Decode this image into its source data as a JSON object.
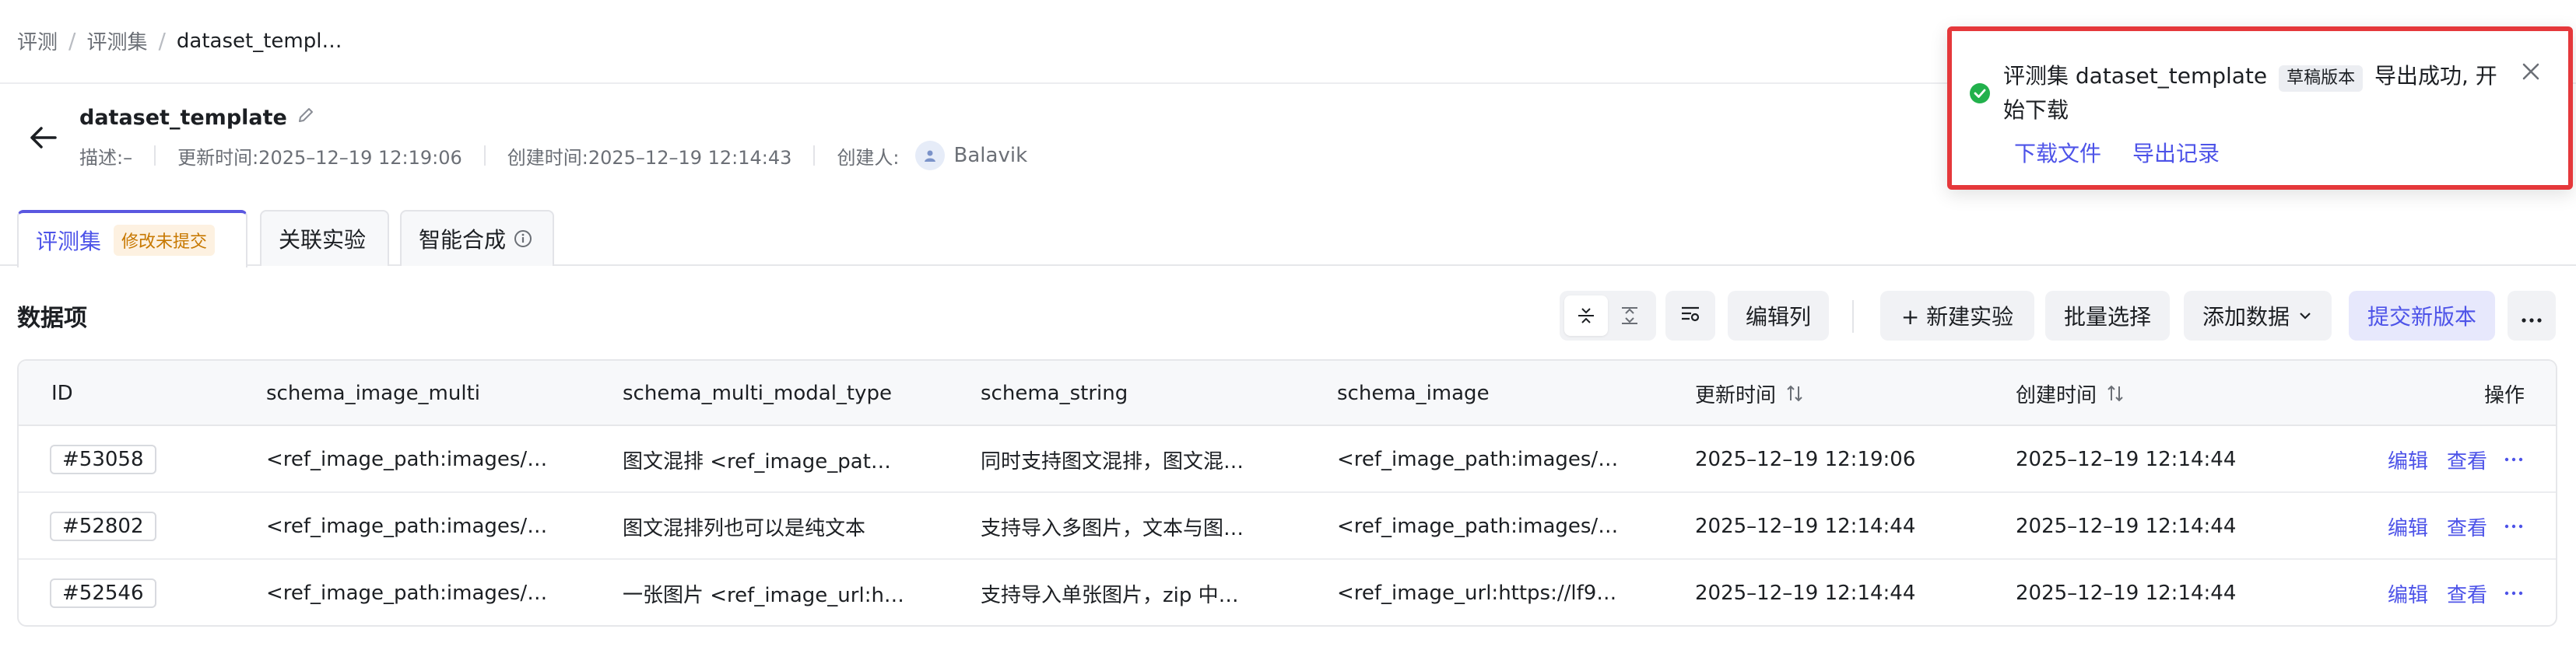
{
  "breadcrumb": [
    "评测",
    "评测集",
    "dataset_templ…"
  ],
  "header": {
    "title": "dataset_template",
    "description": "描述:–",
    "updated": "更新时间:2025–12–19 12:19:06",
    "created": "创建时间:2025–12–19 12:14:43",
    "creator_label": "创建人:",
    "creator_name": "Balavik"
  },
  "tabs": [
    {
      "label": "评测集",
      "badge": "修改未提交"
    },
    {
      "label": "关联实验"
    },
    {
      "label": "智能合成"
    }
  ],
  "section_title": "数据项",
  "toolbar": {
    "edit_columns": "编辑列",
    "new_experiment": "+ 新建实验",
    "batch_select": "批量选择",
    "add_data": "添加数据",
    "submit_version": "提交新版本"
  },
  "table": {
    "columns": [
      "ID",
      "schema_image_multi",
      "schema_multi_modal_type",
      "schema_string",
      "schema_image",
      "更新时间",
      "创建时间",
      "操作"
    ],
    "rows": [
      {
        "id": "#53058",
        "image_multi": "<ref_image_path:images/…",
        "multi_modal": "图文混排 <ref_image_pat…",
        "string": "同时支持图文混排，图文混…",
        "image": "<ref_image_path:images/…",
        "updated": "2025–12–19 12:19:06",
        "created": "2025–12–19 12:14:44",
        "edit": "编辑",
        "view": "查看"
      },
      {
        "id": "#52802",
        "image_multi": "<ref_image_path:images/…",
        "multi_modal": "图文混排列也可以是纯文本",
        "string": "支持导入多图片，文本与图…",
        "image": "<ref_image_path:images/…",
        "updated": "2025–12–19 12:14:44",
        "created": "2025–12–19 12:14:44",
        "edit": "编辑",
        "view": "查看"
      },
      {
        "id": "#52546",
        "image_multi": "<ref_image_path:images/…",
        "multi_modal": "一张图片 <ref_image_url:h…",
        "string": "支持导入单张图片，zip 中…",
        "image": "<ref_image_url:https://lf9…",
        "updated": "2025–12–19 12:14:44",
        "created": "2025–12–19 12:14:44",
        "edit": "编辑",
        "view": "查看"
      }
    ]
  },
  "toast": {
    "prefix": "评测集 dataset_template",
    "draft_badge": "草稿版本",
    "suffix": "导出成功, 开始下载",
    "download_link": "下载文件",
    "records_link": "导出记录"
  },
  "colors": {
    "accent": "#4d53e8",
    "success": "#22b14c",
    "highlight_border": "#e5383b"
  }
}
